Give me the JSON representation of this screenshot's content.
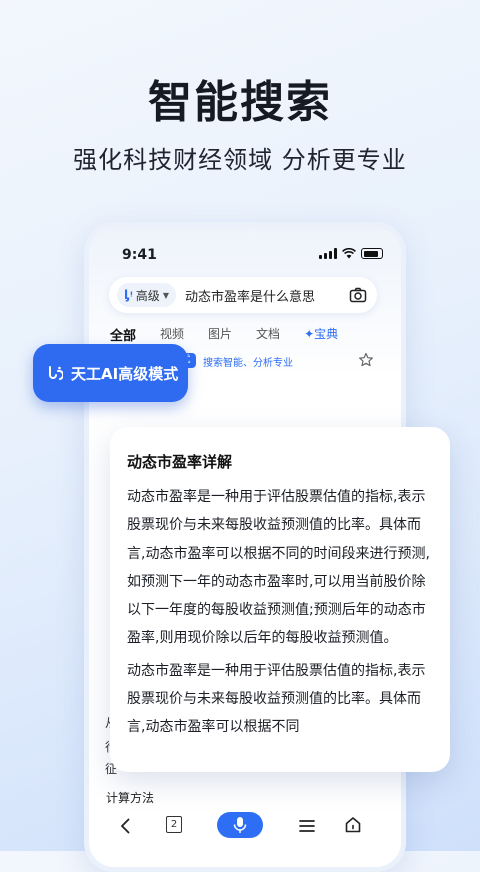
{
  "headline": "智能搜索",
  "subline": "强化科技财经领域 分析更专业",
  "phone": {
    "time": "9:41",
    "search": {
      "mode_label": "高级",
      "query": "动态市盈率是什么意思"
    },
    "tabs": [
      {
        "label": "全部"
      },
      {
        "label": "视频"
      },
      {
        "label": "图片"
      },
      {
        "label": "文档"
      },
      {
        "label": "✦宝典"
      }
    ],
    "banner_tag": "式",
    "banner_text": "搜索智能、分析专业",
    "left_fragments": [
      "从",
      "行",
      "征"
    ],
    "section_label": "计算方法",
    "tab_count": "2"
  },
  "ai_badge": "天工AI高级模式",
  "card": {
    "title": "动态市盈率详解",
    "paragraphs": [
      "动态市盈率是一种用于评估股票估值的指标,表示股票现价与未来每股收益预测值的比率。具体而言,动态市盈率可以根据不同的时间段来进行预测,如预测下一年的动态市盈率时,可以用当前股价除以下一年度的每股收益预测值;预测后年的动态市盈率,则用现价除以后年的每股收益预测值。",
      "动态市盈率是一种用于评估股票估值的指标,表示股票现价与未来每股收益预测值的比率。具体而言,动态市盈率可以根据不同"
    ]
  },
  "colors": {
    "accent": "#2e6ef5",
    "badge": "#2f6bf0"
  }
}
